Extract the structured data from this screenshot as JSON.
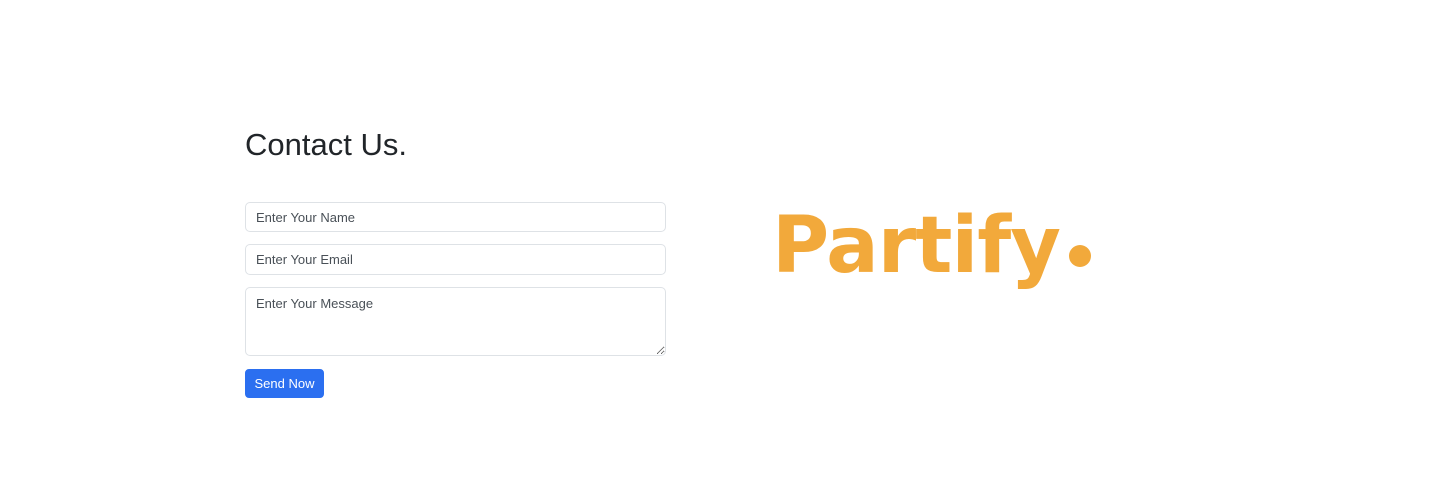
{
  "contact": {
    "title": "Contact Us.",
    "name_placeholder": "Enter Your Name",
    "email_placeholder": "Enter Your Email",
    "message_placeholder": "Enter Your Message",
    "send_label": "Send Now"
  },
  "brand": {
    "name": "Partify",
    "color": "#f2a93b",
    "dot_icon": "dot-icon"
  },
  "colors": {
    "primary_button": "#2b6ff0",
    "border": "#dee2e6",
    "text": "#212529"
  }
}
